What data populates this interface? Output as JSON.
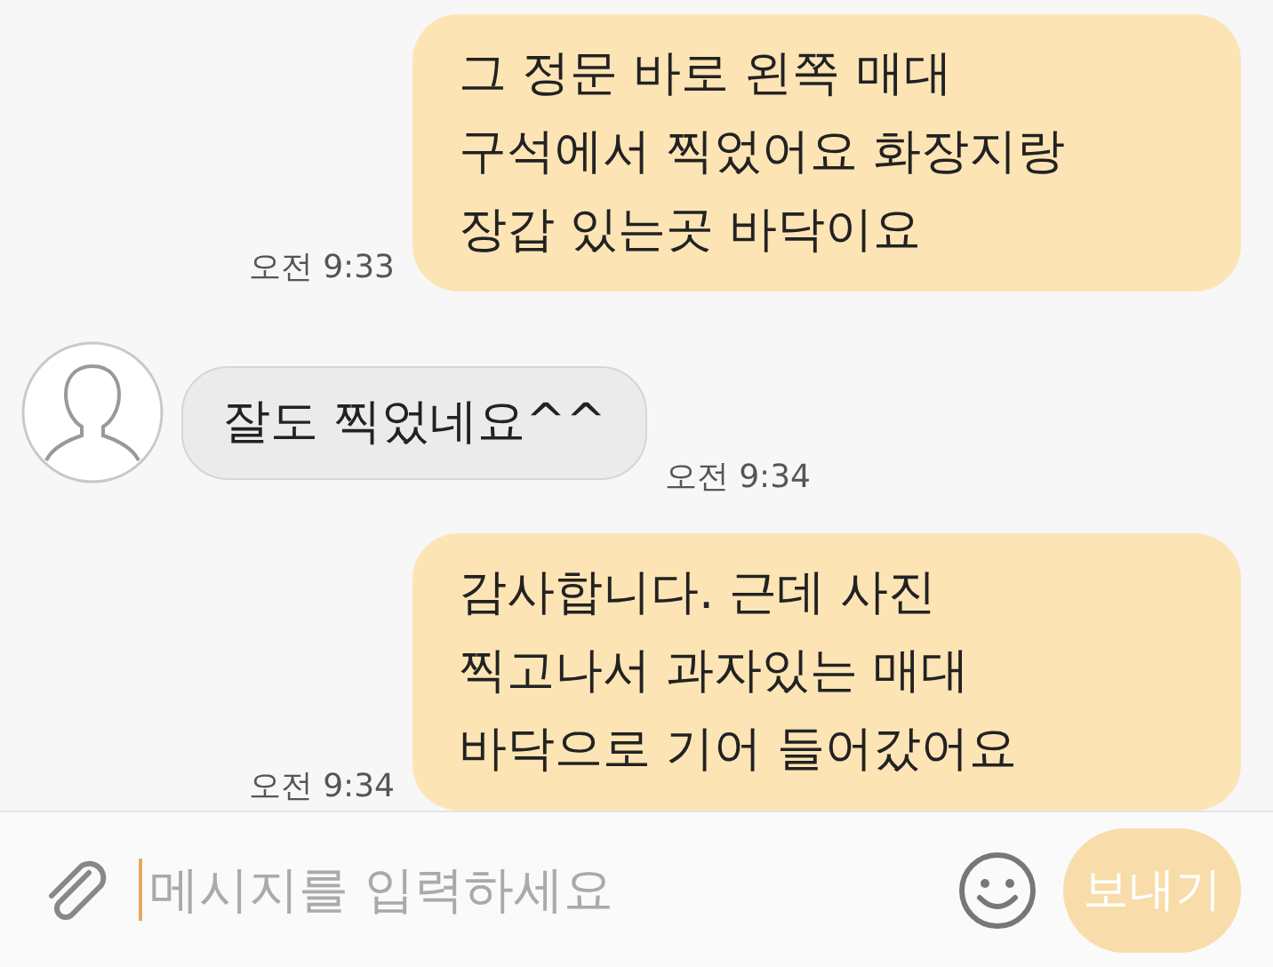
{
  "messages": [
    {
      "kind": "sent",
      "text": "그 정문 바로 왼쪽 매대\n구석에서 찍었어요 화장지랑\n장갑 있는곳 바닥이요",
      "time": "오전 9:33"
    },
    {
      "kind": "received",
      "text": "잘도 찍었네요^^",
      "time": "오전 9:34"
    },
    {
      "kind": "sent",
      "text": "감사합니다. 근데 사진\n찍고나서 과자있는 매대\n바닥으로 기어 들어갔어요",
      "time": "오전 9:34"
    }
  ],
  "composer": {
    "placeholder": "메시지를 입력하세요",
    "send_label": "보내기"
  }
}
